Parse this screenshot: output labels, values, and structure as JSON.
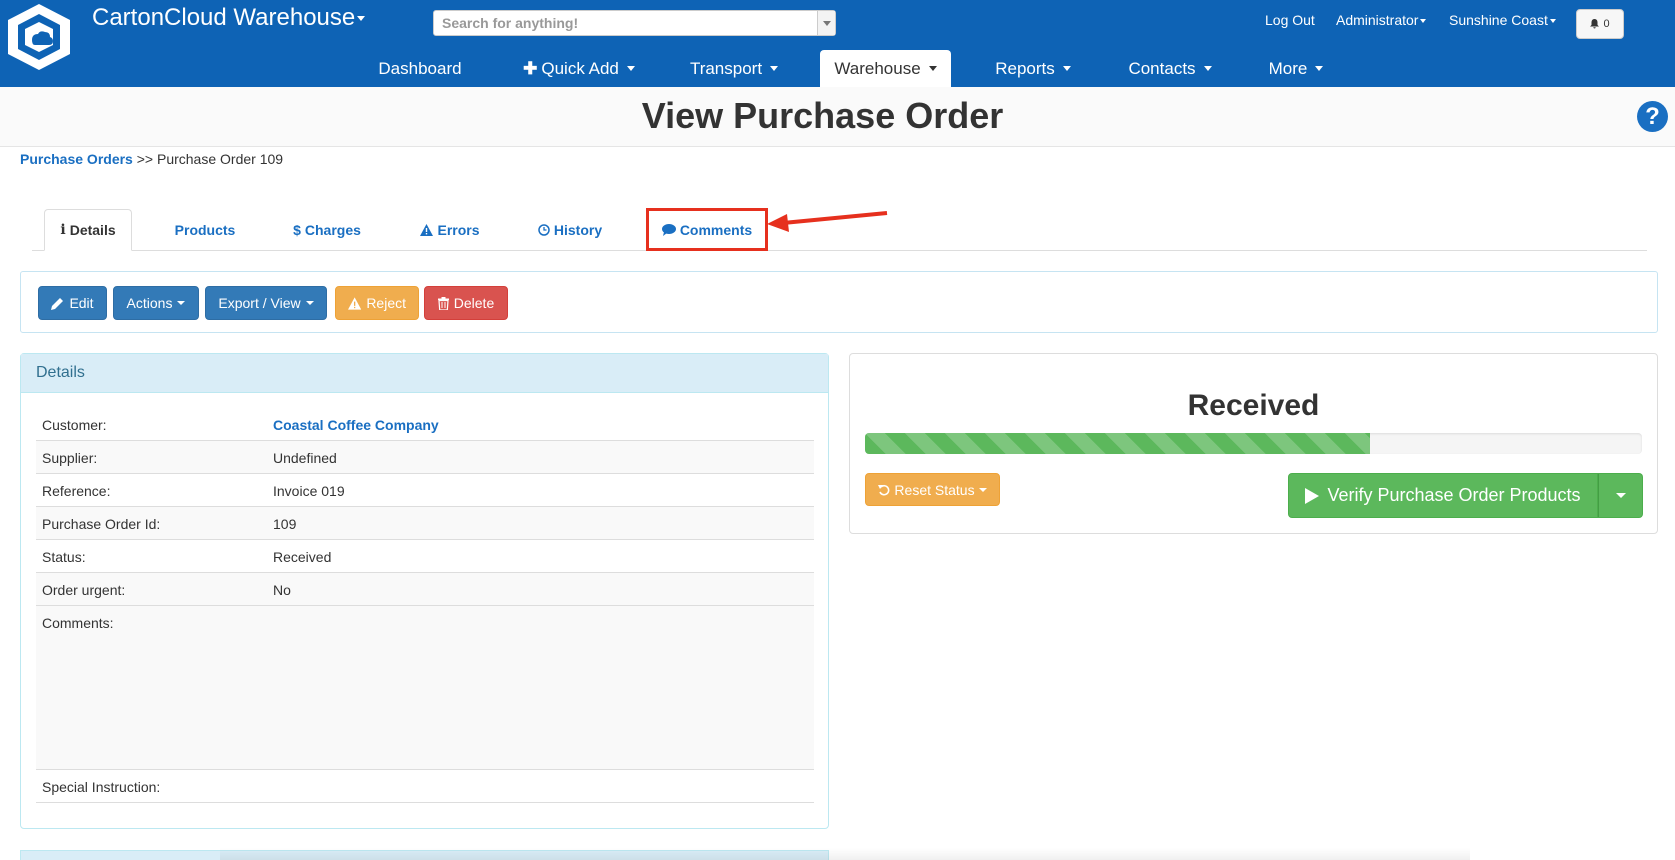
{
  "app": {
    "title": "CartonCloud Warehouse"
  },
  "search": {
    "placeholder": "Search for anything!"
  },
  "top_links": {
    "logout": "Log Out",
    "user": "Administrator",
    "location": "Sunshine Coast",
    "notification_count": "0"
  },
  "nav": {
    "dashboard": "Dashboard",
    "quick_add": "Quick Add",
    "transport": "Transport",
    "warehouse": "Warehouse",
    "reports": "Reports",
    "contacts": "Contacts",
    "more": "More"
  },
  "page": {
    "title": "View Purchase Order",
    "help": "?"
  },
  "breadcrumb": {
    "parent": "Purchase Orders",
    "separator": ">>",
    "current": "Purchase Order 109"
  },
  "tabs": {
    "details": "Details",
    "products": "Products",
    "charges": "Charges",
    "errors": "Errors",
    "history": "History",
    "comments": "Comments"
  },
  "toolbar": {
    "edit": "Edit",
    "actions": "Actions",
    "export_view": "Export / View",
    "reject": "Reject",
    "delete": "Delete"
  },
  "details_panel": {
    "heading": "Details",
    "rows": [
      {
        "label": "Customer:",
        "value": "Coastal Coffee Company"
      },
      {
        "label": "Supplier:",
        "value": "Undefined"
      },
      {
        "label": "Reference:",
        "value": "Invoice 019"
      },
      {
        "label": "Purchase Order Id:",
        "value": "109"
      },
      {
        "label": "Status:",
        "value": "Received"
      },
      {
        "label": "Order urgent:",
        "value": "No"
      },
      {
        "label": "Comments:",
        "value": ""
      },
      {
        "label": "Special Instruction:",
        "value": ""
      }
    ]
  },
  "status_panel": {
    "status": "Received",
    "progress_percent": 65,
    "reset_label": "Reset Status",
    "verify_label": "Verify Purchase Order Products"
  },
  "colors": {
    "topbar": "#0e63b5",
    "link": "#1a6fc2",
    "success": "#5cb85c",
    "warning": "#f0ad4e",
    "danger": "#d9534f",
    "primary": "#337ab7",
    "highlight": "#e6301e"
  }
}
